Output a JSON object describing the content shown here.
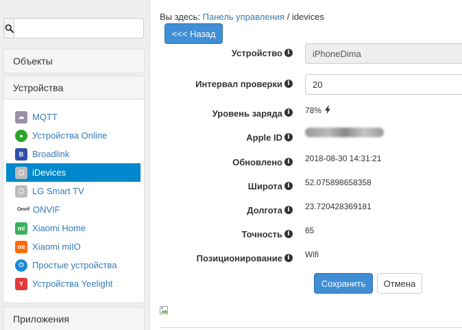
{
  "sidebar": {
    "search": {
      "placeholder": "",
      "icon": "search-icon"
    },
    "objects_label": "Объекты",
    "devices_label": "Устройства",
    "apps_label": "Приложения",
    "devices": [
      {
        "label": "MQTT",
        "icon": "mqtt-icon",
        "color": "#9b8fa8",
        "active": false
      },
      {
        "label": "Устройства Online",
        "icon": "online-icon",
        "color": "#2aa52a",
        "active": false
      },
      {
        "label": "Broadlink",
        "icon": "broadlink-icon",
        "color": "#2f4fa8",
        "active": false
      },
      {
        "label": "iDevices",
        "icon": "idevices-icon",
        "color": "#bcbcbc",
        "active": true
      },
      {
        "label": "LG Smart TV",
        "icon": "lg-tv-icon",
        "color": "#bcbcbc",
        "active": false
      },
      {
        "label": "ONVIF",
        "icon": "onvif-icon",
        "color": "#555555",
        "active": false
      },
      {
        "label": "Xiaomi Home",
        "icon": "xiaomi-home-icon",
        "color": "#3ab15c",
        "active": false
      },
      {
        "label": "Xiaomi miIO",
        "icon": "xiaomi-miio-icon",
        "color": "#ff6a00",
        "active": false
      },
      {
        "label": "Простые устройства",
        "icon": "power-icon",
        "color": "#1a8ad6",
        "active": false
      },
      {
        "label": "Устройства Yeelight",
        "icon": "yeelight-icon",
        "color": "#e03a3a",
        "active": false
      }
    ]
  },
  "breadcrumb": {
    "prefix": "Вы здесь:",
    "link": "Панель управления",
    "separator": "/",
    "current": "idevices"
  },
  "back_button": "<<< Назад",
  "form": {
    "device_label": "Устройство",
    "device_value": "iPhoneDima",
    "interval_label": "Интервал проверки",
    "interval_value": "20",
    "battery_label": "Уровень заряда",
    "battery_value": "78%",
    "battery_icon": "lightning-icon",
    "appleid_label": "Apple ID",
    "updated_label": "Обновлено",
    "updated_value": "2018-08-30 14:31:21",
    "lat_label": "Широта",
    "lat_value": "52.075898658358",
    "lon_label": "Долгота",
    "lon_value": "23.720428369181",
    "accuracy_label": "Точность",
    "accuracy_value": "65",
    "positioning_label": "Позиционирование",
    "positioning_value": "Wifi"
  },
  "save_button": "Сохранить",
  "cancel_button": "Отмена",
  "colors": {
    "primary": "#3f8ed6",
    "link": "#337ab7",
    "active": "#0088cc"
  }
}
